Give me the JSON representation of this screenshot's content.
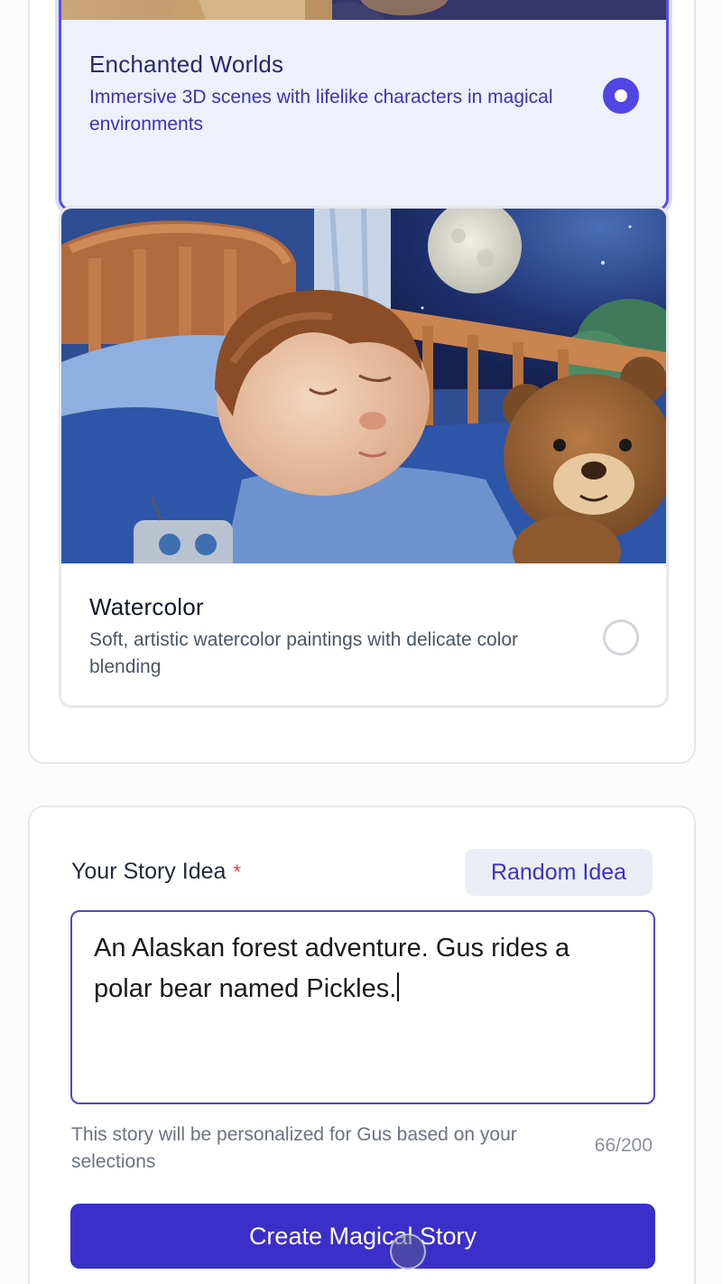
{
  "styles": {
    "items": [
      {
        "title": "Enchanted Worlds",
        "description": "Immersive 3D scenes with lifelike characters in magical environments",
        "selected": true
      },
      {
        "title": "Watercolor",
        "description": "Soft, artistic watercolor paintings with delicate color blending",
        "selected": false
      }
    ]
  },
  "idea": {
    "label": "Your Story Idea",
    "required_mark": "*",
    "random_button": "Random Idea",
    "value": "An Alaskan forest adventure. Gus rides a polar bear named Pickles.",
    "hint": "This story will be personalized for Gus based on your selections",
    "char_count": "66/200"
  },
  "actions": {
    "create_button": "Create Magical Story"
  },
  "colors": {
    "accent": "#4f46e5",
    "button_primary": "#3b2fc9",
    "required": "#e0423b"
  }
}
